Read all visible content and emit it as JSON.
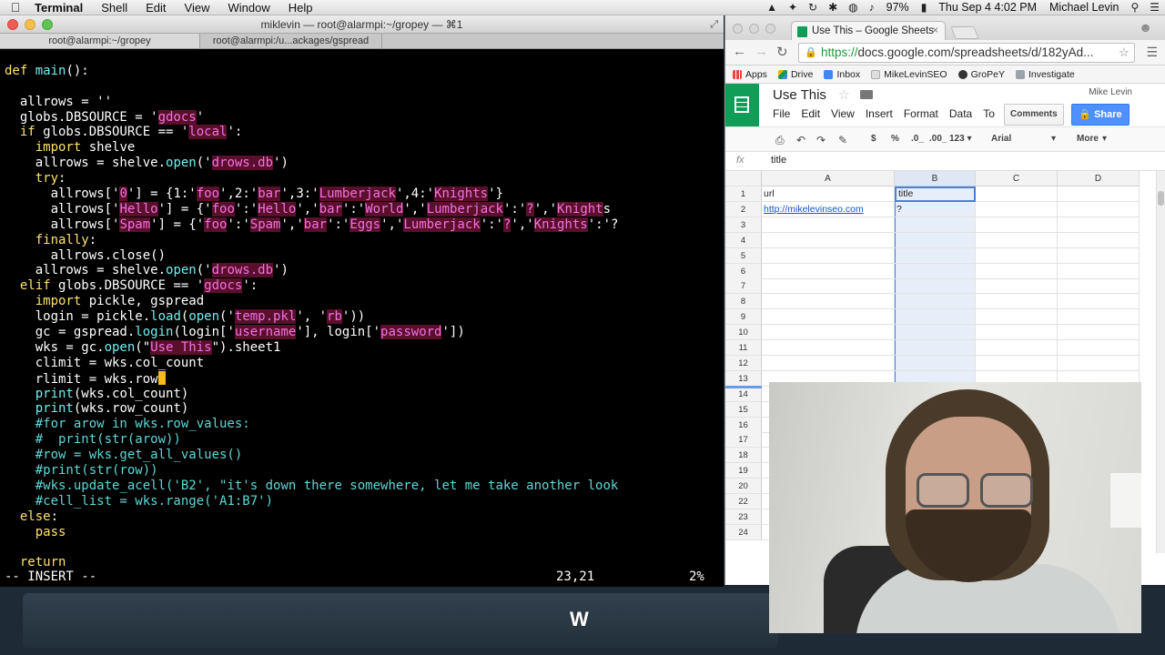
{
  "menubar": {
    "app": "Terminal",
    "items": [
      "Shell",
      "Edit",
      "View",
      "Window",
      "Help"
    ],
    "battery": "97%",
    "datetime": "Thu Sep 4  4:02 PM",
    "user": "Michael Levin"
  },
  "terminal": {
    "title": "miklevin — root@alarmpi:~/gropey — ⌘1",
    "tabs": [
      "root@alarmpi:~/gropey",
      "root@alarmpi:/u...ackages/gspread"
    ],
    "lines": [
      "",
      "def main():",
      "",
      "  allrows = ''",
      "  globs.DBSOURCE = 'gdocs'",
      "  if globs.DBSOURCE == 'local':",
      "    import shelve",
      "    allrows = shelve.open('drows.db')",
      "    try:",
      "      allrows['0'] = {1:'foo',2:'bar',3:'Lumberjack',4:'Knights'}",
      "      allrows['Hello'] = {'foo':'Hello','bar':'World','Lumberjack':'?','Knights",
      "      allrows['Spam'] = {'foo':'Spam','bar':'Eggs','Lumberjack':'?','Knights':'?",
      "    finally:",
      "      allrows.close()",
      "    allrows = shelve.open('drows.db')",
      "  elif globs.DBSOURCE == 'gdocs':",
      "    import pickle, gspread",
      "    login = pickle.load(open('temp.pkl', 'rb'))",
      "    gc = gspread.login(login['username'], login['password'])",
      "    wks = gc.open(\"Use This\").sheet1",
      "    climit = wks.col_count",
      "    rlimit = wks.row",
      "    print(wks.col_count)",
      "    print(wks.row_count)",
      "    #for arow in wks.row_values:",
      "    #  print(str(arow))",
      "    #row = wks.get_all_values()",
      "    #print(str(row))",
      "    #wks.update_acell('B2', \"it's down there somewhere, let me take another look",
      "    #cell_list = wks.range('A1:B7')",
      "  else:",
      "    pass",
      "",
      "  return"
    ],
    "status_mode": "-- INSERT --",
    "status_pos": "23,21",
    "status_pct": "2%"
  },
  "chrome": {
    "tab_title": "Use This – Google Sheets",
    "url_scheme": "https://",
    "url_rest": "docs.google.com/spreadsheets/d/182yAd...",
    "bookmarks": [
      "Apps",
      "Drive",
      "Inbox",
      "MikeLevinSEO",
      "GroPeY",
      "Investigate"
    ]
  },
  "sheets": {
    "doc_title": "Use This",
    "menu": [
      "File",
      "Edit",
      "View",
      "Insert",
      "Format",
      "Data",
      "To"
    ],
    "user": "Mike Levin",
    "comments_label": "Comments",
    "share_label": "Share",
    "toolbar": {
      "currency": "$",
      "percent": "%",
      "decimal_less": ".0_",
      "decimal_more": ".00_",
      "number_format": "123 ▾",
      "font": "Arial",
      "more": "More"
    },
    "fx_label": "fx",
    "fx_value": "title",
    "columns": [
      "A",
      "B",
      "C",
      "D"
    ],
    "rows": [
      "1",
      "2",
      "3",
      "4",
      "5",
      "6",
      "7",
      "8",
      "9",
      "10",
      "11",
      "12",
      "13",
      "14",
      "15",
      "16",
      "17",
      "18",
      "19",
      "20",
      "22",
      "23",
      "24"
    ],
    "cells": {
      "A1": "url",
      "B1": "title",
      "A2": "http://mikelevinseo.com",
      "B2": "?"
    }
  },
  "desktop": {
    "logo": "W"
  }
}
